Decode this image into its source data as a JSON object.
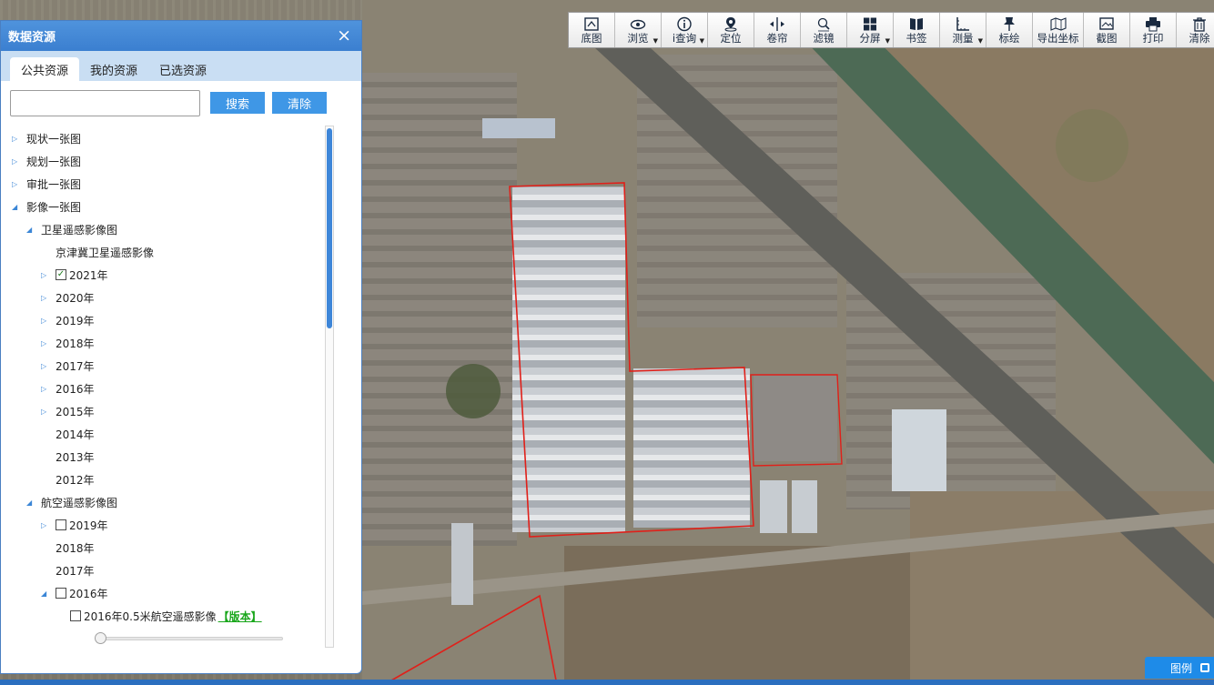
{
  "toolbar": {
    "items": [
      {
        "label": "底图",
        "icon": "basemap-icon",
        "dropdown": false
      },
      {
        "label": "浏览",
        "icon": "eye-icon",
        "dropdown": true
      },
      {
        "label": "i查询",
        "icon": "info-icon",
        "dropdown": true
      },
      {
        "label": "定位",
        "icon": "locate-icon",
        "dropdown": false
      },
      {
        "label": "卷帘",
        "icon": "swipe-icon",
        "dropdown": false
      },
      {
        "label": "滤镜",
        "icon": "filter-icon",
        "dropdown": false
      },
      {
        "label": "分屏",
        "icon": "split-screen-icon",
        "dropdown": true
      },
      {
        "label": "书签",
        "icon": "bookmark-icon",
        "dropdown": false
      },
      {
        "label": "测量",
        "icon": "ruler-icon",
        "dropdown": true
      },
      {
        "label": "标绘",
        "icon": "pin-icon",
        "dropdown": false
      },
      {
        "label": "导出坐标",
        "icon": "export-coordinates-icon",
        "dropdown": false
      },
      {
        "label": "截图",
        "icon": "screenshot-icon",
        "dropdown": false
      },
      {
        "label": "打印",
        "icon": "printer-icon",
        "dropdown": false
      },
      {
        "label": "清除",
        "icon": "trash-icon",
        "dropdown": false
      }
    ]
  },
  "panel": {
    "title": "数据资源",
    "close_glyph": "×",
    "tabs": [
      "公共资源",
      "我的资源",
      "已选资源"
    ],
    "active_tab": 0,
    "search": {
      "value": "",
      "placeholder": ""
    },
    "search_button": "搜索",
    "clear_button": "清除",
    "tree": [
      {
        "label": "现状一张图",
        "level": 0,
        "arrow": "collapsed",
        "checkbox": "none"
      },
      {
        "label": "规划一张图",
        "level": 0,
        "arrow": "collapsed",
        "checkbox": "none"
      },
      {
        "label": "审批一张图",
        "level": 0,
        "arrow": "collapsed",
        "checkbox": "none"
      },
      {
        "label": "影像一张图",
        "level": 0,
        "arrow": "expanded",
        "checkbox": "none"
      },
      {
        "label": "卫星遥感影像图",
        "level": 1,
        "arrow": "expanded",
        "checkbox": "none"
      },
      {
        "label": "京津冀卫星遥感影像",
        "level": 2,
        "arrow": "none",
        "checkbox": "none"
      },
      {
        "label": "2021年",
        "level": 2,
        "arrow": "collapsed",
        "checkbox": "checked"
      },
      {
        "label": "2020年",
        "level": 2,
        "arrow": "collapsed",
        "checkbox": "none"
      },
      {
        "label": "2019年",
        "level": 2,
        "arrow": "collapsed",
        "checkbox": "none"
      },
      {
        "label": "2018年",
        "level": 2,
        "arrow": "collapsed",
        "checkbox": "none"
      },
      {
        "label": "2017年",
        "level": 2,
        "arrow": "collapsed",
        "checkbox": "none"
      },
      {
        "label": "2016年",
        "level": 2,
        "arrow": "collapsed",
        "checkbox": "none"
      },
      {
        "label": "2015年",
        "level": 2,
        "arrow": "collapsed",
        "checkbox": "none"
      },
      {
        "label": "2014年",
        "level": 2,
        "arrow": "none",
        "checkbox": "none"
      },
      {
        "label": "2013年",
        "level": 2,
        "arrow": "none",
        "checkbox": "none"
      },
      {
        "label": "2012年",
        "level": 2,
        "arrow": "none",
        "checkbox": "none"
      },
      {
        "label": "航空遥感影像图",
        "level": 1,
        "arrow": "expanded",
        "checkbox": "none"
      },
      {
        "label": "2019年",
        "level": 2,
        "arrow": "collapsed",
        "checkbox": "unchecked"
      },
      {
        "label": "2018年",
        "level": 2,
        "arrow": "none",
        "checkbox": "none"
      },
      {
        "label": "2017年",
        "level": 2,
        "arrow": "none",
        "checkbox": "none"
      },
      {
        "label": "2016年",
        "level": 2,
        "arrow": "expanded",
        "checkbox": "unchecked"
      },
      {
        "label": "2016年0.5米航空遥感影像",
        "level": 3,
        "arrow": "none",
        "checkbox": "unchecked",
        "link": "【版本】"
      }
    ],
    "opacity_slider": 0
  },
  "legend": {
    "label": "图例",
    "icon": "legend-toggle-icon"
  },
  "colors": {
    "accent": "#3f97e6",
    "panel_header": "#3b7fd0",
    "parcel_outline": "#e0201a",
    "version_link": "#19a61b"
  }
}
